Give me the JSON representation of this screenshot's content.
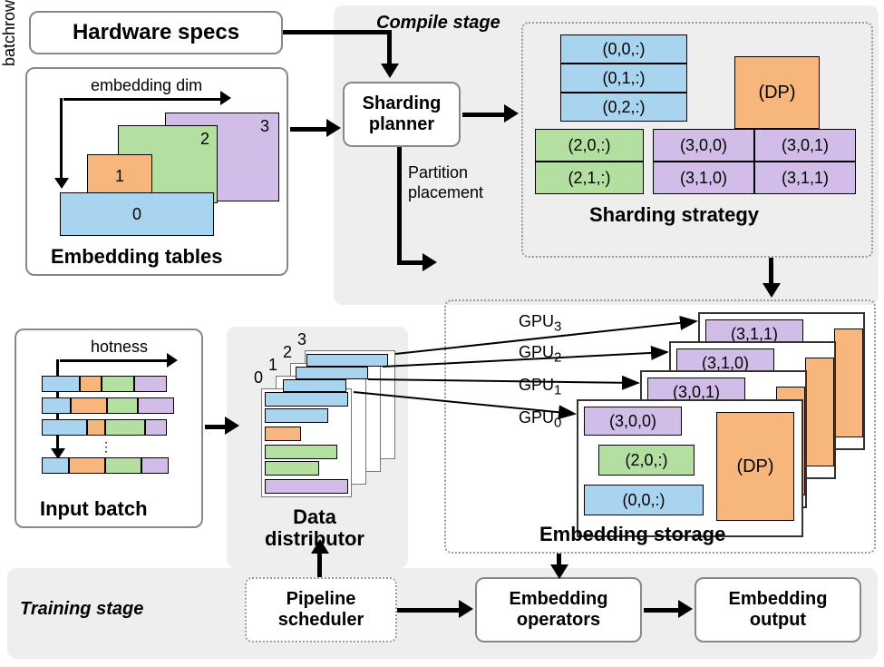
{
  "hardware_specs": "Hardware specs",
  "compile_stage": "Compile stage",
  "training_stage": "Training stage",
  "sharding_planner": "Sharding\nplanner",
  "partition_placement": "Partition\nplacement",
  "embedding_tables": {
    "title": "Embedding tables",
    "x_axis": "embedding dim",
    "y_axis": "row",
    "items": [
      "0",
      "1",
      "2",
      "3"
    ]
  },
  "sharding_strategy": {
    "title": "Sharding strategy",
    "dp": "(DP)",
    "blue": [
      "(0,0,:)",
      "(0,1,:)",
      "(0,2,:)"
    ],
    "green": [
      "(2,0,:)",
      "(2,1,:)"
    ],
    "purple": [
      "(3,0,0)",
      "(3,0,1)",
      "(3,1,0)",
      "(3,1,1)"
    ]
  },
  "input_batch": {
    "title": "Input batch",
    "x_axis": "hotness",
    "y_axis": "batch"
  },
  "data_distributor": {
    "title": "Data\ndistributor",
    "indices": [
      "0",
      "1",
      "2",
      "3"
    ]
  },
  "embedding_storage": {
    "title": "Embedding storage",
    "gpus": [
      "GPU",
      "GPU",
      "GPU",
      "GPU"
    ],
    "gpu_sub": [
      "0",
      "1",
      "2",
      "3"
    ],
    "dp": "(DP)",
    "gpu0": [
      "(3,0,0)",
      "(2,0,:)",
      "(0,0,:)"
    ],
    "gpu1": "(3,0,1)",
    "gpu2": "(3,1,0)",
    "gpu3": "(3,1,1)"
  },
  "pipeline_scheduler": "Pipeline\nscheduler",
  "embedding_operators": "Embedding\noperators",
  "embedding_output": "Embedding\noutput"
}
